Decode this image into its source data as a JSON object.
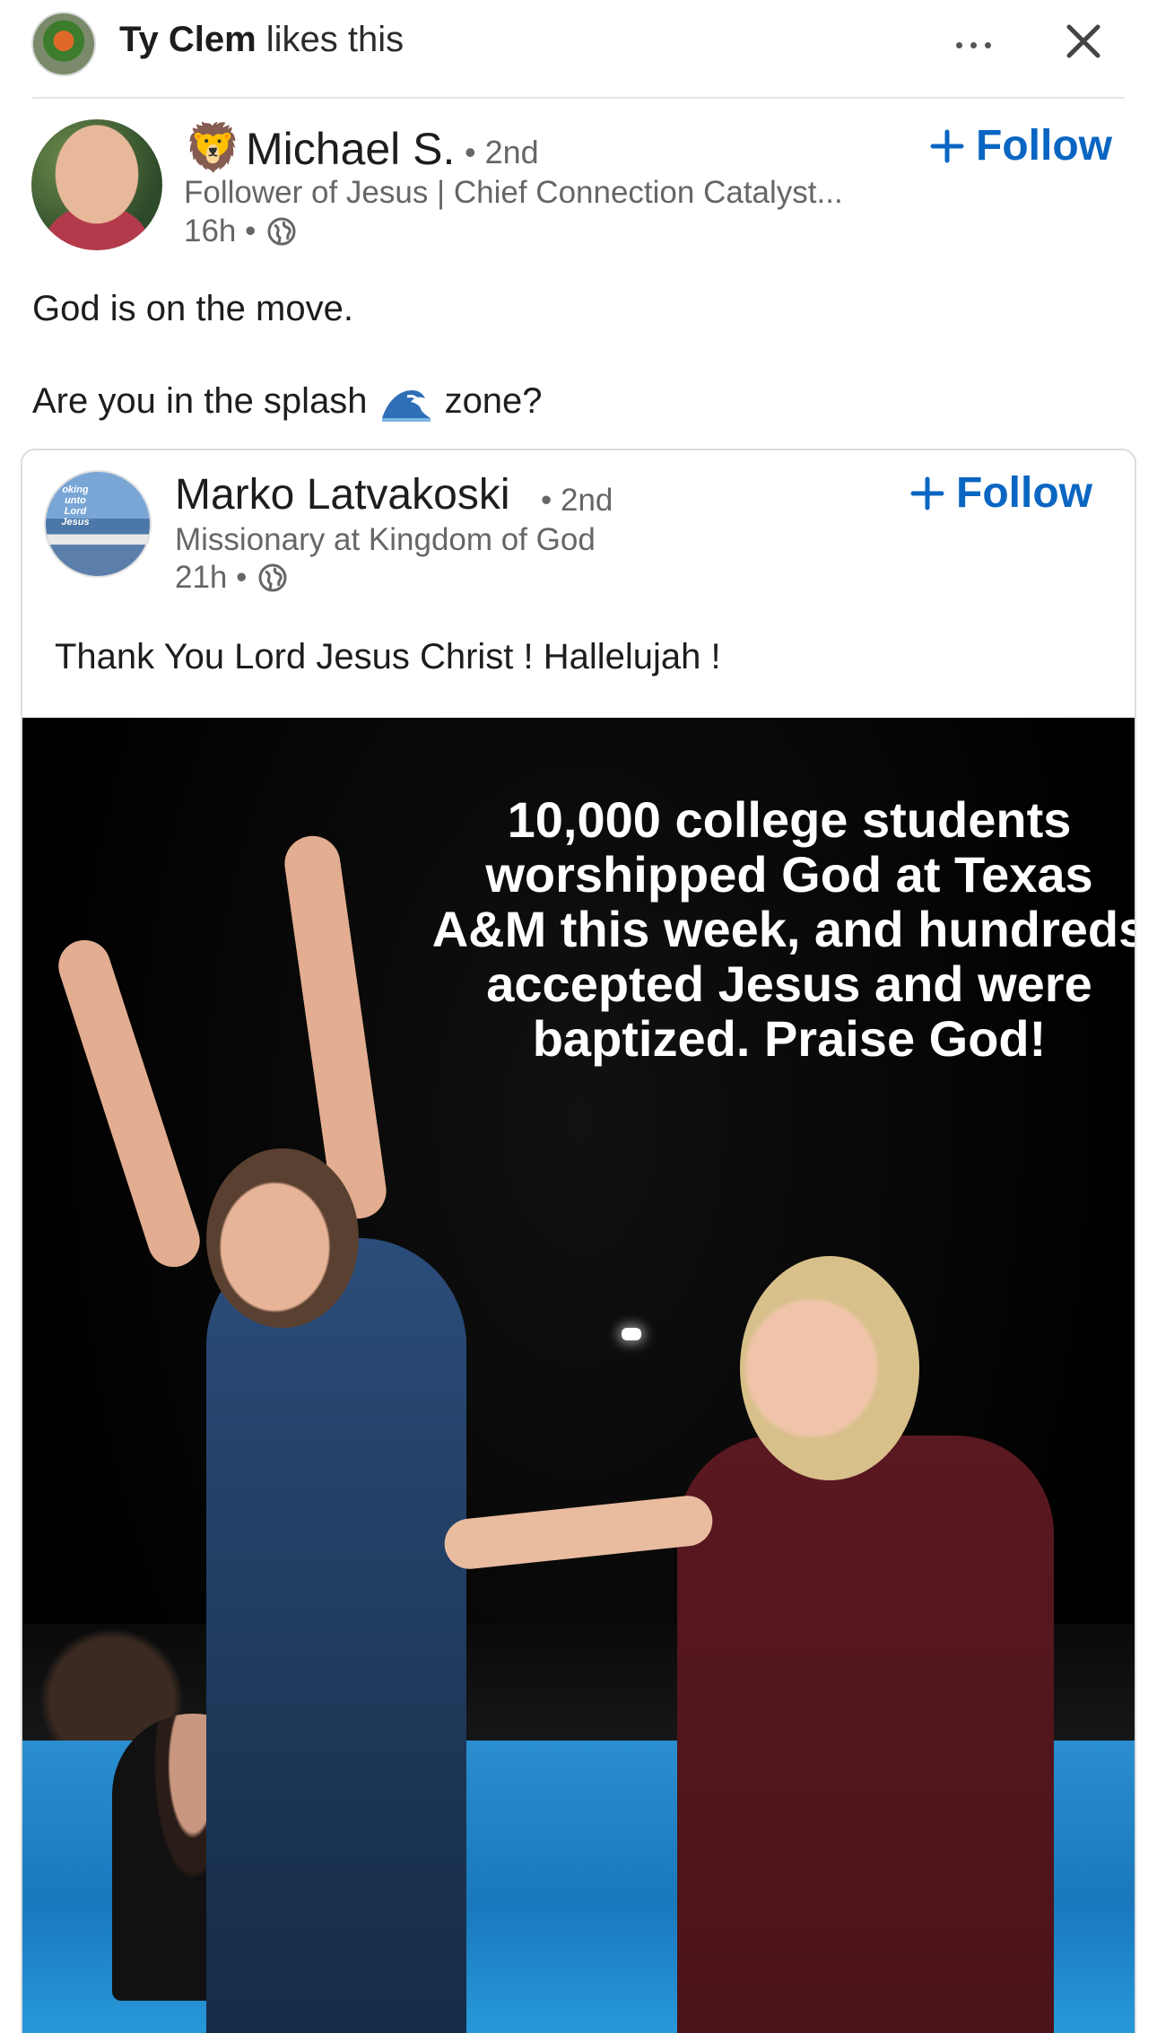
{
  "context": {
    "actor": "Ty Clem",
    "action": " likes this"
  },
  "post": {
    "author_emoji": "🦁",
    "author_name": "Michael S.",
    "author_degree": "• 2nd",
    "author_headline": "Follower of Jesus | Chief Connection Catalyst...",
    "time": "16h •",
    "follow_label": "Follow",
    "text_line1": "God is on the move.",
    "text_line2_before": "Are you in the splash",
    "text_line2_after": "zone?"
  },
  "shared": {
    "avatar_text": "oking unto Lord Jesus",
    "author_name": "Marko Latvakoski",
    "author_degree": "• 2nd",
    "author_headline": "Missionary at Kingdom of God",
    "time": "21h •",
    "follow_label": "Follow",
    "text": "Thank You Lord Jesus Christ ! Hallelujah !",
    "image_caption": "10,000 college students worshipped God at Texas A&M this week, and hundreds accepted Jesus and were baptized. Praise God!"
  },
  "icons": {
    "more": "more-icon",
    "close": "close-icon",
    "globe": "globe-icon",
    "plus": "plus-icon",
    "wave": "wave-icon"
  },
  "colors": {
    "link_blue": "#0a66c2",
    "muted_text": "#666666"
  }
}
